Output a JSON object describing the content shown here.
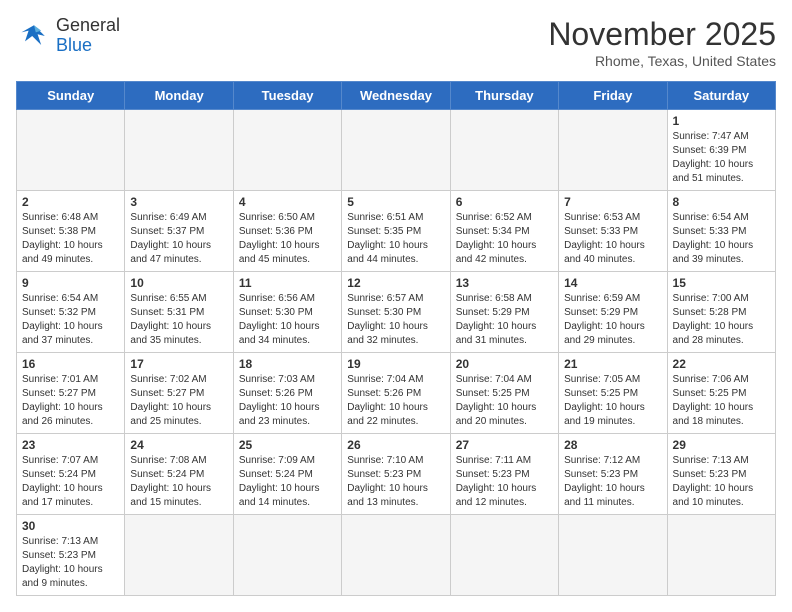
{
  "header": {
    "logo_general": "General",
    "logo_blue": "Blue",
    "title": "November 2025",
    "location": "Rhome, Texas, United States"
  },
  "days_of_week": [
    "Sunday",
    "Monday",
    "Tuesday",
    "Wednesday",
    "Thursday",
    "Friday",
    "Saturday"
  ],
  "weeks": [
    [
      {
        "day": "",
        "info": ""
      },
      {
        "day": "",
        "info": ""
      },
      {
        "day": "",
        "info": ""
      },
      {
        "day": "",
        "info": ""
      },
      {
        "day": "",
        "info": ""
      },
      {
        "day": "",
        "info": ""
      },
      {
        "day": "1",
        "info": "Sunrise: 7:47 AM\nSunset: 6:39 PM\nDaylight: 10 hours\nand 51 minutes."
      }
    ],
    [
      {
        "day": "2",
        "info": "Sunrise: 6:48 AM\nSunset: 5:38 PM\nDaylight: 10 hours\nand 49 minutes."
      },
      {
        "day": "3",
        "info": "Sunrise: 6:49 AM\nSunset: 5:37 PM\nDaylight: 10 hours\nand 47 minutes."
      },
      {
        "day": "4",
        "info": "Sunrise: 6:50 AM\nSunset: 5:36 PM\nDaylight: 10 hours\nand 45 minutes."
      },
      {
        "day": "5",
        "info": "Sunrise: 6:51 AM\nSunset: 5:35 PM\nDaylight: 10 hours\nand 44 minutes."
      },
      {
        "day": "6",
        "info": "Sunrise: 6:52 AM\nSunset: 5:34 PM\nDaylight: 10 hours\nand 42 minutes."
      },
      {
        "day": "7",
        "info": "Sunrise: 6:53 AM\nSunset: 5:33 PM\nDaylight: 10 hours\nand 40 minutes."
      },
      {
        "day": "8",
        "info": "Sunrise: 6:54 AM\nSunset: 5:33 PM\nDaylight: 10 hours\nand 39 minutes."
      }
    ],
    [
      {
        "day": "9",
        "info": "Sunrise: 6:54 AM\nSunset: 5:32 PM\nDaylight: 10 hours\nand 37 minutes."
      },
      {
        "day": "10",
        "info": "Sunrise: 6:55 AM\nSunset: 5:31 PM\nDaylight: 10 hours\nand 35 minutes."
      },
      {
        "day": "11",
        "info": "Sunrise: 6:56 AM\nSunset: 5:30 PM\nDaylight: 10 hours\nand 34 minutes."
      },
      {
        "day": "12",
        "info": "Sunrise: 6:57 AM\nSunset: 5:30 PM\nDaylight: 10 hours\nand 32 minutes."
      },
      {
        "day": "13",
        "info": "Sunrise: 6:58 AM\nSunset: 5:29 PM\nDaylight: 10 hours\nand 31 minutes."
      },
      {
        "day": "14",
        "info": "Sunrise: 6:59 AM\nSunset: 5:29 PM\nDaylight: 10 hours\nand 29 minutes."
      },
      {
        "day": "15",
        "info": "Sunrise: 7:00 AM\nSunset: 5:28 PM\nDaylight: 10 hours\nand 28 minutes."
      }
    ],
    [
      {
        "day": "16",
        "info": "Sunrise: 7:01 AM\nSunset: 5:27 PM\nDaylight: 10 hours\nand 26 minutes."
      },
      {
        "day": "17",
        "info": "Sunrise: 7:02 AM\nSunset: 5:27 PM\nDaylight: 10 hours\nand 25 minutes."
      },
      {
        "day": "18",
        "info": "Sunrise: 7:03 AM\nSunset: 5:26 PM\nDaylight: 10 hours\nand 23 minutes."
      },
      {
        "day": "19",
        "info": "Sunrise: 7:04 AM\nSunset: 5:26 PM\nDaylight: 10 hours\nand 22 minutes."
      },
      {
        "day": "20",
        "info": "Sunrise: 7:04 AM\nSunset: 5:25 PM\nDaylight: 10 hours\nand 20 minutes."
      },
      {
        "day": "21",
        "info": "Sunrise: 7:05 AM\nSunset: 5:25 PM\nDaylight: 10 hours\nand 19 minutes."
      },
      {
        "day": "22",
        "info": "Sunrise: 7:06 AM\nSunset: 5:25 PM\nDaylight: 10 hours\nand 18 minutes."
      }
    ],
    [
      {
        "day": "23",
        "info": "Sunrise: 7:07 AM\nSunset: 5:24 PM\nDaylight: 10 hours\nand 17 minutes."
      },
      {
        "day": "24",
        "info": "Sunrise: 7:08 AM\nSunset: 5:24 PM\nDaylight: 10 hours\nand 15 minutes."
      },
      {
        "day": "25",
        "info": "Sunrise: 7:09 AM\nSunset: 5:24 PM\nDaylight: 10 hours\nand 14 minutes."
      },
      {
        "day": "26",
        "info": "Sunrise: 7:10 AM\nSunset: 5:23 PM\nDaylight: 10 hours\nand 13 minutes."
      },
      {
        "day": "27",
        "info": "Sunrise: 7:11 AM\nSunset: 5:23 PM\nDaylight: 10 hours\nand 12 minutes."
      },
      {
        "day": "28",
        "info": "Sunrise: 7:12 AM\nSunset: 5:23 PM\nDaylight: 10 hours\nand 11 minutes."
      },
      {
        "day": "29",
        "info": "Sunrise: 7:13 AM\nSunset: 5:23 PM\nDaylight: 10 hours\nand 10 minutes."
      }
    ],
    [
      {
        "day": "30",
        "info": "Sunrise: 7:13 AM\nSunset: 5:23 PM\nDaylight: 10 hours\nand 9 minutes."
      },
      {
        "day": "",
        "info": ""
      },
      {
        "day": "",
        "info": ""
      },
      {
        "day": "",
        "info": ""
      },
      {
        "day": "",
        "info": ""
      },
      {
        "day": "",
        "info": ""
      },
      {
        "day": "",
        "info": ""
      }
    ]
  ]
}
